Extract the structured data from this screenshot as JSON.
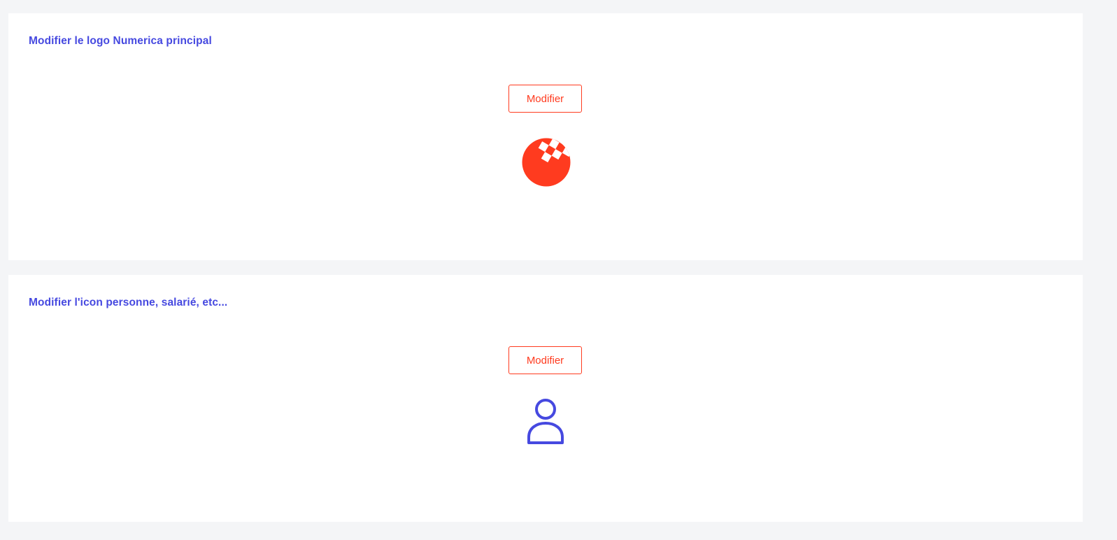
{
  "colors": {
    "accent_blue": "#4649e0",
    "accent_red": "#ff3b1f",
    "background": "#f4f5f7",
    "card": "#ffffff"
  },
  "sections": [
    {
      "title": "Modifier le logo Numerica principal",
      "button_label": "Modifier",
      "preview_icon": "numerica-logo-icon"
    },
    {
      "title": "Modifier l'icon personne, salarié, etc...",
      "button_label": "Modifier",
      "preview_icon": "person-icon"
    }
  ]
}
